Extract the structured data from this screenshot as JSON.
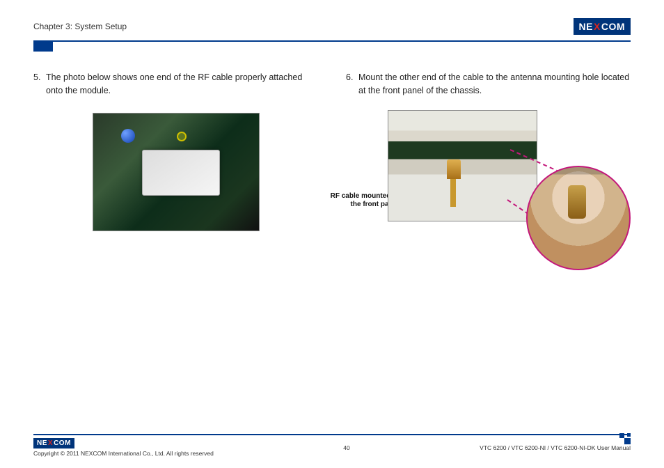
{
  "header": {
    "chapter": "Chapter 3: System Setup",
    "logo_left": "NE",
    "logo_x": "X",
    "logo_right": "COM"
  },
  "left_column": {
    "step_number": "5.",
    "step_text": "The photo below shows one end of the RF cable properly attached onto the module."
  },
  "right_column": {
    "step_number": "6.",
    "step_text": "Mount the other end of the cable to the antenna mounting hole located at the front panel of the chassis.",
    "caption": "RF cable mounted at the front panel"
  },
  "footer": {
    "logo_left": "NE",
    "logo_x": "X",
    "logo_right": "COM",
    "copyright": "Copyright © 2011 NEXCOM International Co., Ltd. All rights reserved",
    "page_number": "40",
    "doc_title": "VTC 6200 / VTC 6200-NI / VTC 6200-NI-DK User Manual"
  }
}
